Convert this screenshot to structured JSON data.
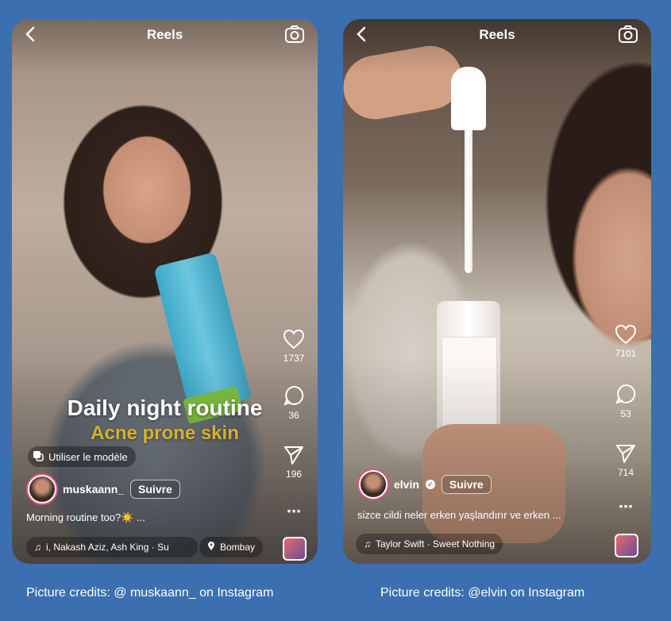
{
  "reel_left": {
    "header": {
      "title": "Reels"
    },
    "overlay": {
      "line1": "Daily night routine",
      "line2": "Acne prone skin"
    },
    "template_label": "Utiliser le modèle",
    "actions": {
      "likes": "1737",
      "comments": "36",
      "shares": "196"
    },
    "user": {
      "name": "muskaann_",
      "follow": "Suivre"
    },
    "caption": "Morning routine too?☀️ ...",
    "music": "i, Nakash Aziz, Ash King · Su",
    "location": "Bombay"
  },
  "reel_right": {
    "header": {
      "title": "Reels"
    },
    "actions": {
      "likes": "7101",
      "comments": "53",
      "shares": "714"
    },
    "user": {
      "name": "elvin",
      "follow": "Suivre"
    },
    "caption": "sizce cildi neler erken yaşlandırır ve erken ...",
    "music": "Taylor Swift · Sweet Nothing"
  },
  "credits": {
    "left": "Picture credits: @ muskaann_ on Instagram",
    "right": "Picture credits: @elvin on Instagram"
  },
  "icons": [
    "back-icon",
    "camera-icon",
    "heart-icon",
    "comment-icon",
    "share-icon",
    "more-icon",
    "music-note-icon",
    "location-icon",
    "template-icon",
    "verified-icon"
  ]
}
